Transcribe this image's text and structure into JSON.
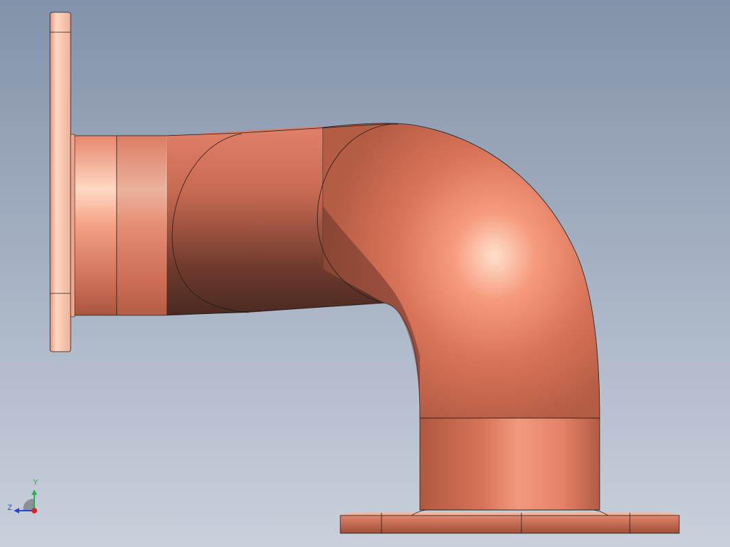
{
  "viewport": {
    "background_top": "#8392aa",
    "background_bottom": "#c9d0dc"
  },
  "model": {
    "name": "pipe-elbow-assembly",
    "material_color": "#d9735a",
    "highlight_color": "#ffd2bb",
    "shadow_color": "#4a2a22",
    "edge_color": "#1a1a1a",
    "components": [
      "left-flange",
      "left-pipe-stub",
      "straight-section",
      "elbow-section",
      "vertical-pipe-stub",
      "bottom-flange"
    ]
  },
  "triad": {
    "y_label": "Y",
    "z_label": "Z",
    "y_color": "#22b14c",
    "z_color": "#2244cc",
    "x_color": "#dd2222"
  }
}
